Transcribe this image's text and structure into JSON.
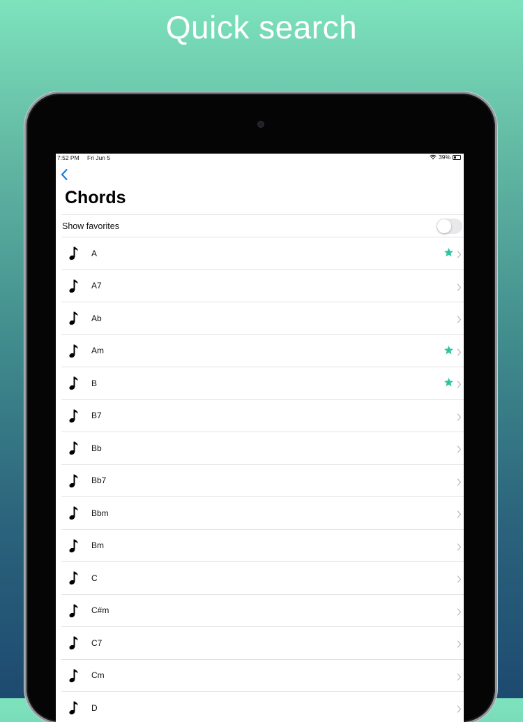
{
  "headline": "Quick search",
  "statusbar": {
    "time": "7:52 PM",
    "date": "Fri Jun 5",
    "battery": "39%"
  },
  "nav": {
    "back_icon": "chevron-left-icon",
    "title": "Chords"
  },
  "favorites": {
    "label": "Show favorites",
    "enabled": false
  },
  "colors": {
    "accent": "#1a7fe0",
    "star": "#2ec4a0",
    "background_top": "#7de3bd",
    "background_bottom": "#1d4a70"
  },
  "chords": [
    {
      "name": "A",
      "favorite": true
    },
    {
      "name": "A7",
      "favorite": false
    },
    {
      "name": "Ab",
      "favorite": false
    },
    {
      "name": "Am",
      "favorite": true
    },
    {
      "name": "B",
      "favorite": true
    },
    {
      "name": "B7",
      "favorite": false
    },
    {
      "name": "Bb",
      "favorite": false
    },
    {
      "name": "Bb7",
      "favorite": false
    },
    {
      "name": "Bbm",
      "favorite": false
    },
    {
      "name": "Bm",
      "favorite": false
    },
    {
      "name": "C",
      "favorite": false
    },
    {
      "name": "C#m",
      "favorite": false
    },
    {
      "name": "C7",
      "favorite": false
    },
    {
      "name": "Cm",
      "favorite": false
    },
    {
      "name": "D",
      "favorite": false
    }
  ]
}
